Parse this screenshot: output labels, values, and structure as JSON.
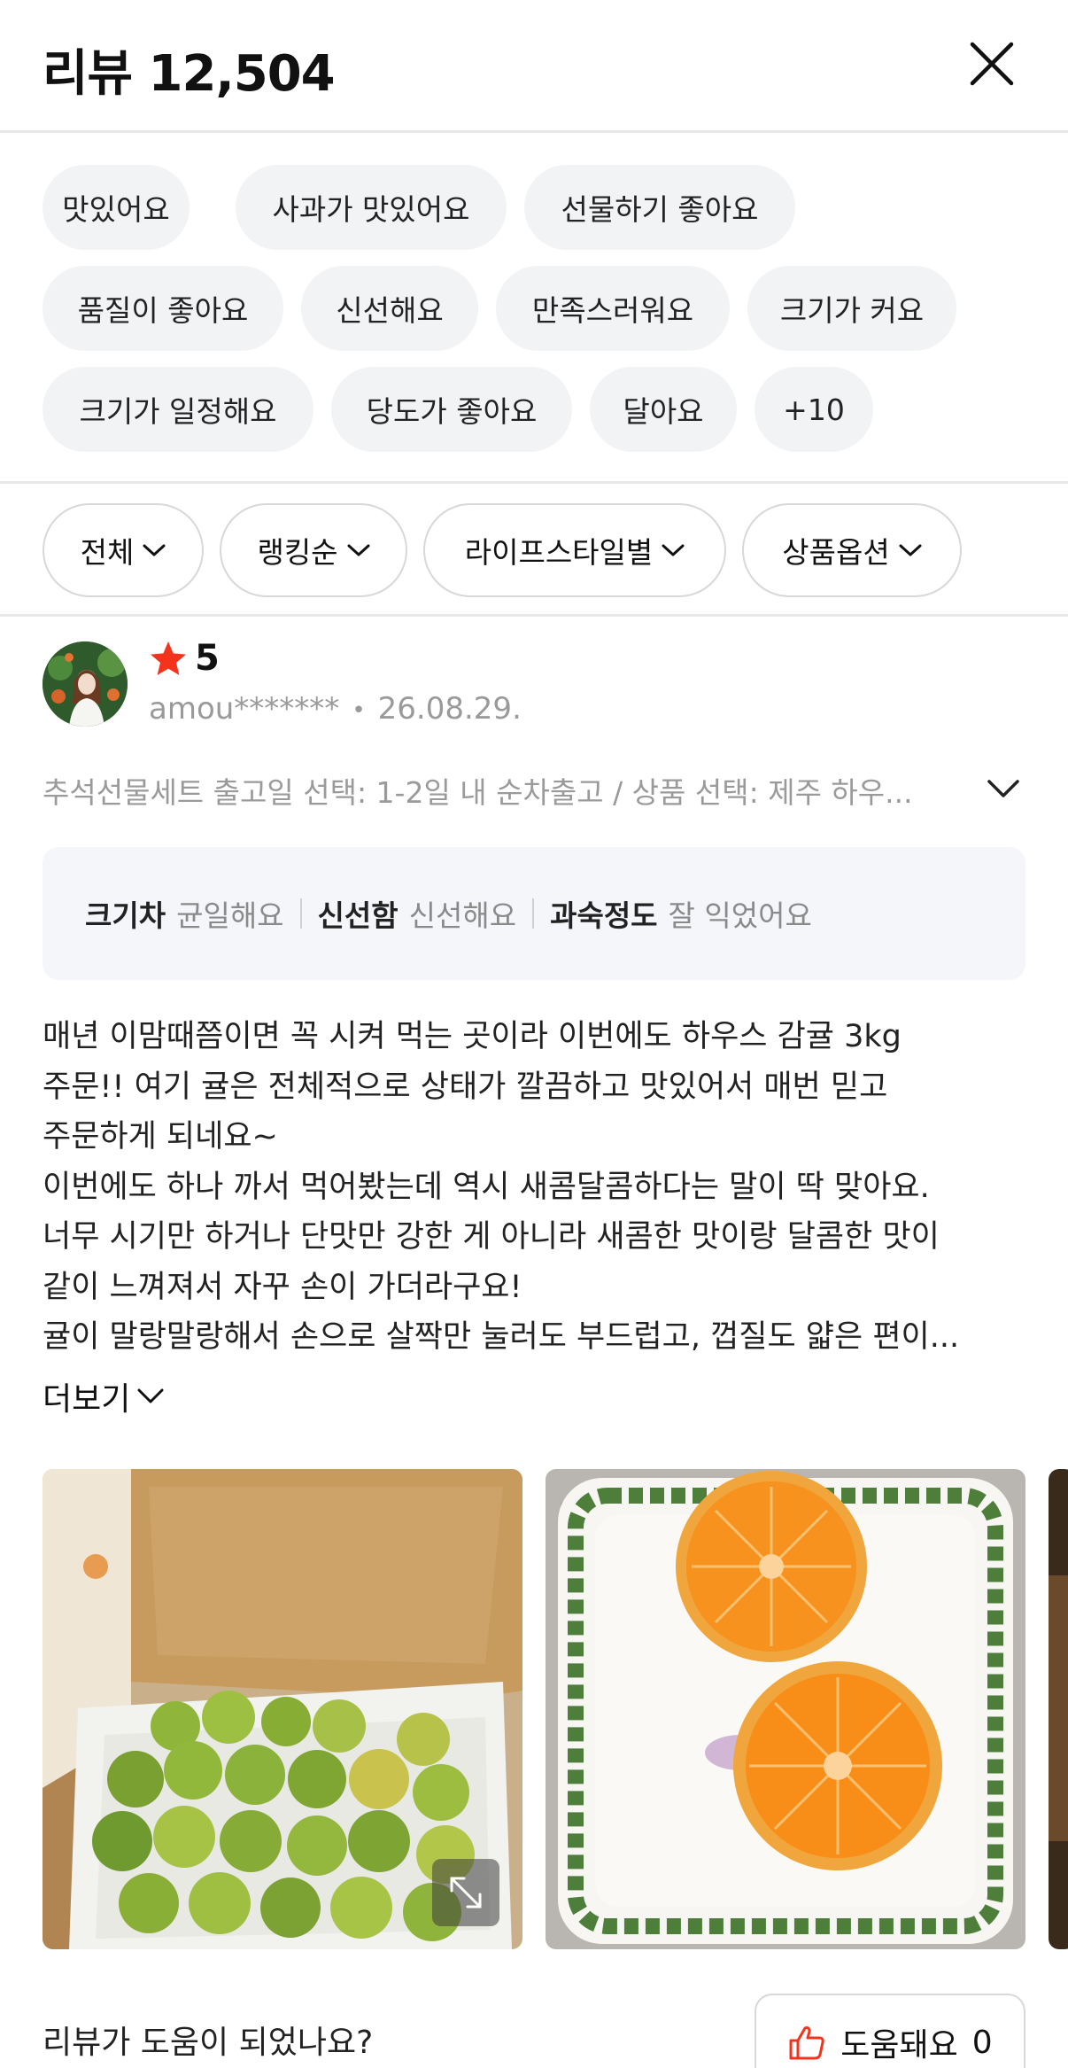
{
  "header": {
    "title": "리뷰 12,504",
    "close_icon": "close-icon"
  },
  "tags": [
    "맛있어요",
    "사과가 맛있어요",
    "선물하기 좋아요",
    "품질이 좋아요",
    "신선해요",
    "만족스러워요",
    "크기가 커요",
    "크기가 일정해요",
    "당도가 좋아요",
    "달아요",
    "+10"
  ],
  "filters": [
    {
      "label": "전체"
    },
    {
      "label": "랭킹순"
    },
    {
      "label": "라이프스타일별"
    },
    {
      "label": "상품옵션"
    }
  ],
  "review": {
    "rating": "5",
    "rating_icon": "star-icon",
    "star_color": "#f5331c",
    "user": "amou*******",
    "date": "26.08.29.",
    "option": "추석선물세트 출고일 선택: 1-2일 내 순차출고 / 상품 선택: 제주 하우...",
    "attributes": [
      {
        "key": "크기차",
        "value": "균일해요"
      },
      {
        "key": "신선함",
        "value": "신선해요"
      },
      {
        "key": "과숙정도",
        "value": "잘 익었어요"
      }
    ],
    "lines": [
      "매년 이맘때쯤이면 꼭 시켜 먹는 곳이라 이번에도 하우스 감귤 3kg",
      "주문!! 여기 귤은 전체적으로 상태가 깔끔하고 맛있어서 매번 믿고",
      "주문하게 되네요~",
      "이번에도 하나 까서 먹어봤는데 역시 새콤달콤하다는 말이 딱 맞아요.",
      "너무 시기만 하거나 단맛만 강한 게 아니라 새콤한 맛이랑 달콤한 맛이",
      "같이 느껴져서 자꾸 손이 가더라구요!",
      "귤이 말랑말랑해서 손으로 살짝만 눌러도 부드럽고, 껍질도 얇은 편이..."
    ],
    "more_label": "더보기",
    "photos": [
      "tangerine-box-photo",
      "halved-tangerine-plate-photo",
      "third-photo"
    ],
    "helpful_question": "리뷰가 도움이 되었나요?",
    "helpful_label": "도움돼요",
    "helpful_count": "0",
    "helpful_icon": "thumbs-up-icon",
    "accent_color": "#f5331c"
  }
}
